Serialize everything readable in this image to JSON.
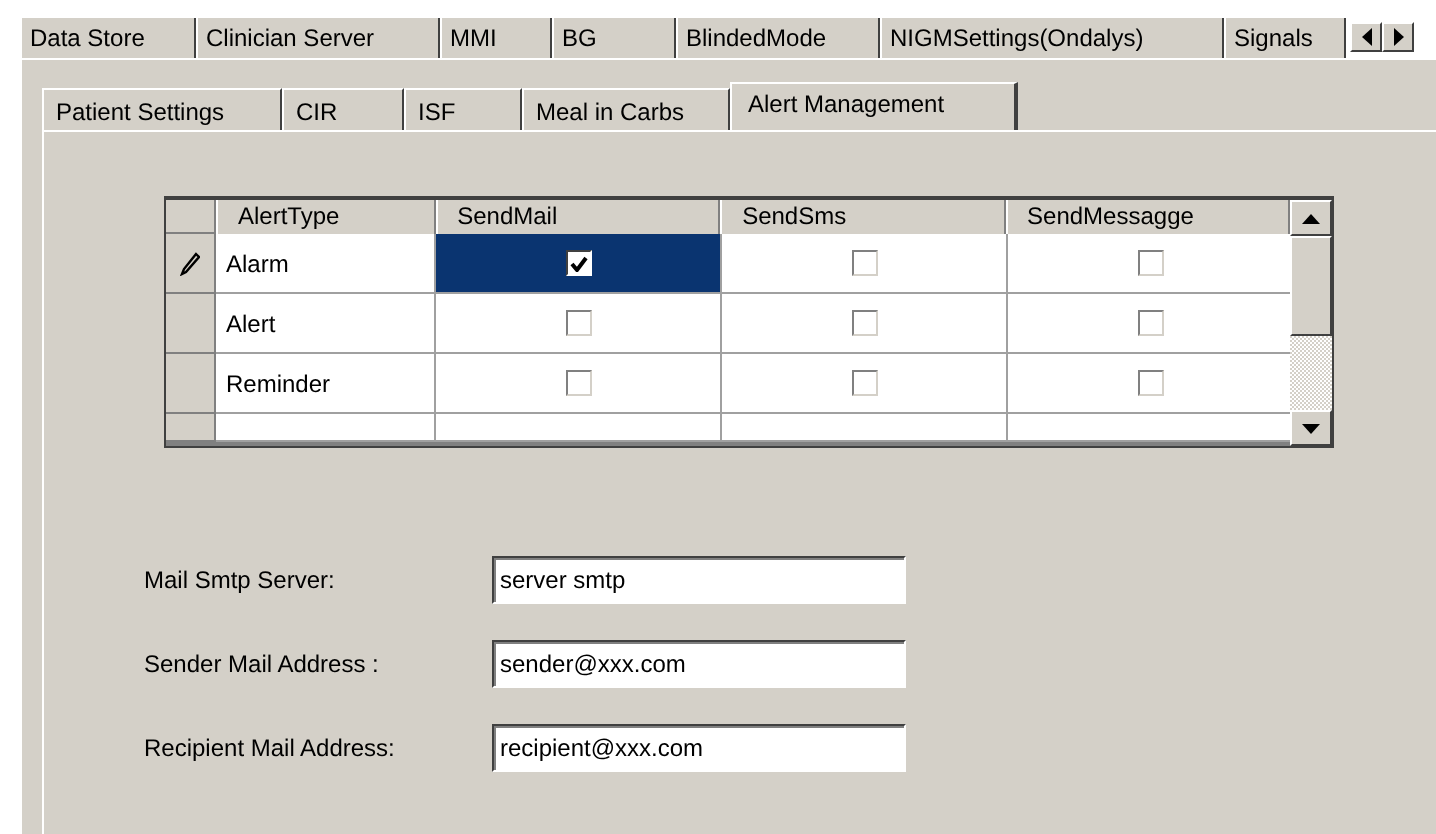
{
  "outer_tabs": [
    {
      "label": "Data Store",
      "selected": false
    },
    {
      "label": "Clinician Server",
      "selected": false
    },
    {
      "label": "MMI",
      "selected": false
    },
    {
      "label": "BG",
      "selected": false
    },
    {
      "label": "BlindedMode",
      "selected": false
    },
    {
      "label": "NIGMSettings(Ondalys)",
      "selected": false
    },
    {
      "label": "Signals",
      "selected": false
    }
  ],
  "inner_tabs": [
    {
      "label": "Patient Settings",
      "selected": false
    },
    {
      "label": "CIR",
      "selected": false
    },
    {
      "label": "ISF",
      "selected": false
    },
    {
      "label": "Meal in Carbs",
      "selected": false
    },
    {
      "label": "Alert Management",
      "selected": true
    }
  ],
  "grid": {
    "columns": [
      "AlertType",
      "SendMail",
      "SendSms",
      "SendMessagge"
    ],
    "rows": [
      {
        "editing": true,
        "alert_type": "Alarm",
        "checks": [
          {
            "checked": true,
            "selected": true
          },
          {
            "checked": false,
            "selected": false
          },
          {
            "checked": false,
            "selected": false
          }
        ]
      },
      {
        "editing": false,
        "alert_type": "Alert",
        "checks": [
          {
            "checked": false,
            "selected": false
          },
          {
            "checked": false,
            "selected": false
          },
          {
            "checked": false,
            "selected": false
          }
        ]
      },
      {
        "editing": false,
        "alert_type": "Reminder",
        "checks": [
          {
            "checked": false,
            "selected": false
          },
          {
            "checked": false,
            "selected": false
          },
          {
            "checked": false,
            "selected": false
          }
        ]
      }
    ]
  },
  "fields": [
    {
      "label": "Mail Smtp Server:",
      "value": "server smtp"
    },
    {
      "label": "Sender Mail Address :",
      "value": "sender@xxx.com"
    },
    {
      "label": "Recipient Mail Address:",
      "value": "recipient@xxx.com"
    }
  ]
}
